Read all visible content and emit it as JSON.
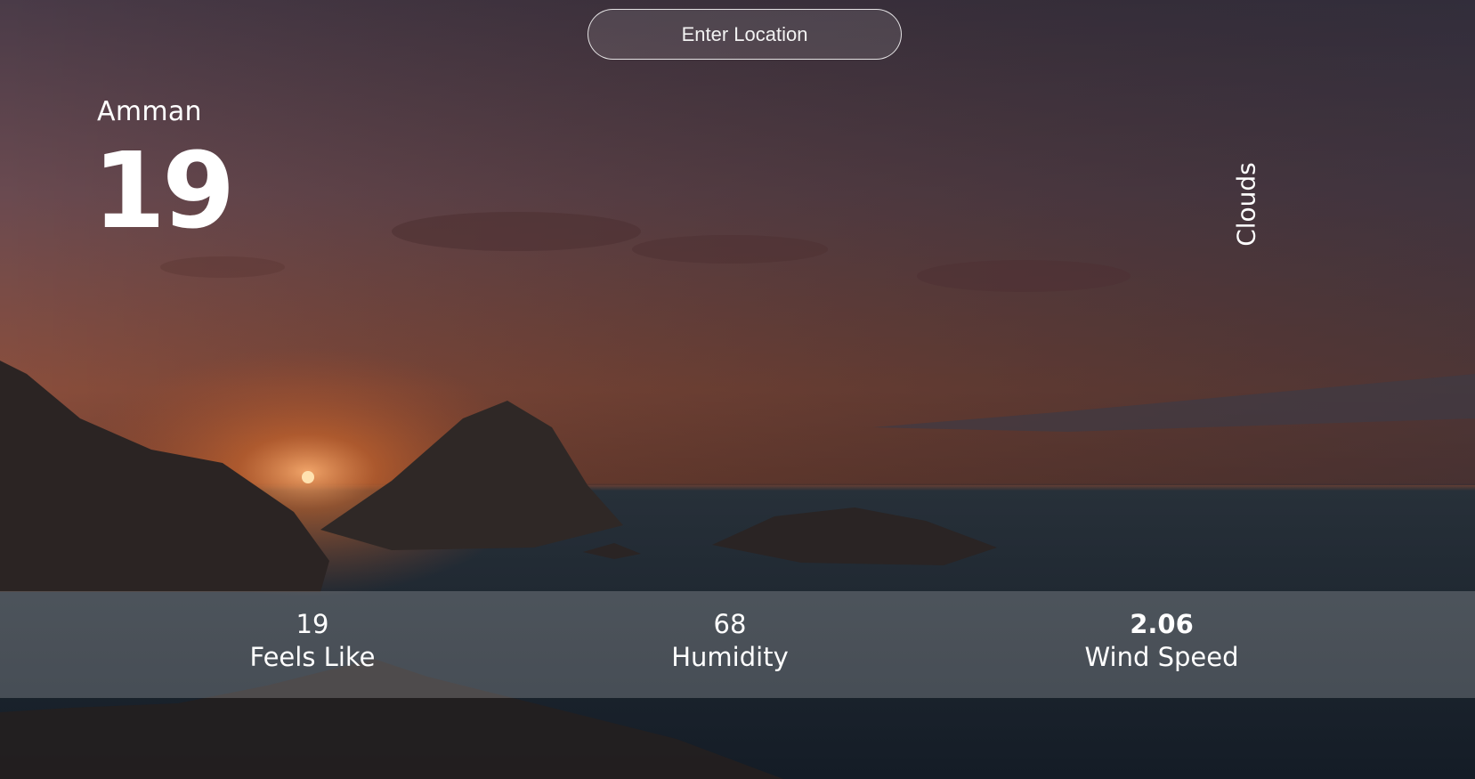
{
  "search": {
    "placeholder": "Enter Location"
  },
  "weather": {
    "city": "Amman",
    "temperature": "19",
    "condition": "Clouds"
  },
  "stats": {
    "feels_like": {
      "value": "19",
      "label": "Feels Like"
    },
    "humidity": {
      "value": "68",
      "label": "Humidity"
    },
    "wind_speed": {
      "value": "2.06",
      "label": "Wind Speed"
    }
  }
}
